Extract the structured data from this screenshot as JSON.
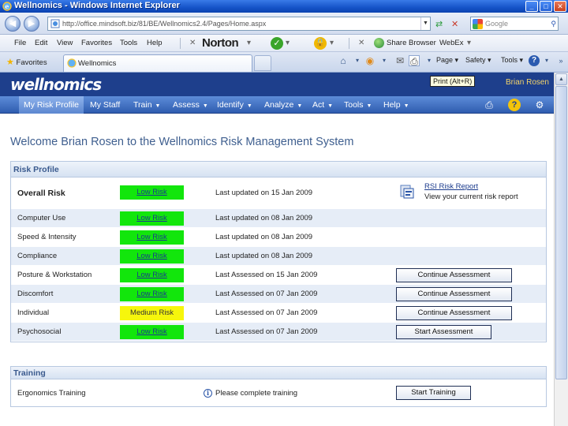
{
  "window": {
    "title": "Wellnomics - Windows Internet Explorer"
  },
  "address": {
    "url": "http://office.mindsoft.biz/81/BE/Wellnomics2.4/Pages/Home.aspx"
  },
  "search": {
    "placeholder": "Google"
  },
  "menu": {
    "file": "File",
    "edit": "Edit",
    "view": "View",
    "favorites": "Favorites",
    "tools": "Tools",
    "help": "Help"
  },
  "norton": {
    "label": "Norton"
  },
  "share": {
    "label": "Share Browser",
    "webex": "WebEx"
  },
  "tabs": {
    "favorites": "Favorites",
    "active_tab": "Wellnomics"
  },
  "commandbar": {
    "page": "Page",
    "safety": "Safety",
    "tools": "Tools"
  },
  "app": {
    "logo": "wellnomics",
    "user": "Brian Rosen",
    "tooltip": "Print (Alt+R)"
  },
  "nav": {
    "items": [
      {
        "label": "My Risk Profile"
      },
      {
        "label": "My Staff"
      },
      {
        "label": "Train"
      },
      {
        "label": "Assess"
      },
      {
        "label": "Identify"
      },
      {
        "label": "Analyze"
      },
      {
        "label": "Act"
      },
      {
        "label": "Tools"
      },
      {
        "label": "Help"
      }
    ]
  },
  "welcome": "Welcome Brian Rosen to the Wellnomics Risk Management System",
  "risk_profile": {
    "heading": "Risk Profile",
    "overall": {
      "label": "Overall Risk",
      "risk": "Low Risk",
      "updated": "Last updated on 15 Jan 2009"
    },
    "rsi": {
      "link": "RSI Risk Report",
      "sub": "View your current risk report"
    },
    "rows": [
      {
        "label": "Computer Use",
        "risk": "Low Risk",
        "updated": "Last updated on 08 Jan 2009",
        "action": ""
      },
      {
        "label": "Speed & Intensity",
        "risk": "Low Risk",
        "updated": "Last updated on 08 Jan 2009",
        "action": ""
      },
      {
        "label": "Compliance",
        "risk": "Low Risk",
        "updated": "Last updated on 08 Jan 2009",
        "action": ""
      },
      {
        "label": "Posture & Workstation",
        "risk": "Low Risk",
        "updated": "Last Assessed on 15 Jan 2009",
        "action": "Continue Assessment"
      },
      {
        "label": "Discomfort",
        "risk": "Low Risk",
        "updated": "Last Assessed on 07 Jan 2009",
        "action": "Continue Assessment"
      },
      {
        "label": "Individual",
        "risk": "Medium Risk",
        "updated": "Last Assessed on 07 Jan 2009",
        "action": "Continue Assessment"
      },
      {
        "label": "Psychosocial",
        "risk": "Low Risk",
        "updated": "Last Assessed on 07 Jan 2009",
        "action": "Start Assessment"
      }
    ]
  },
  "training": {
    "heading": "Training",
    "row": {
      "label": "Ergonomics Training",
      "status": "Please complete training",
      "action": "Start Training"
    }
  },
  "colors": {
    "banner": "#1e3f8c",
    "low_risk": "#12e60c",
    "medium_risk": "#f6f60c",
    "heading_text": "#3f5f8f"
  }
}
